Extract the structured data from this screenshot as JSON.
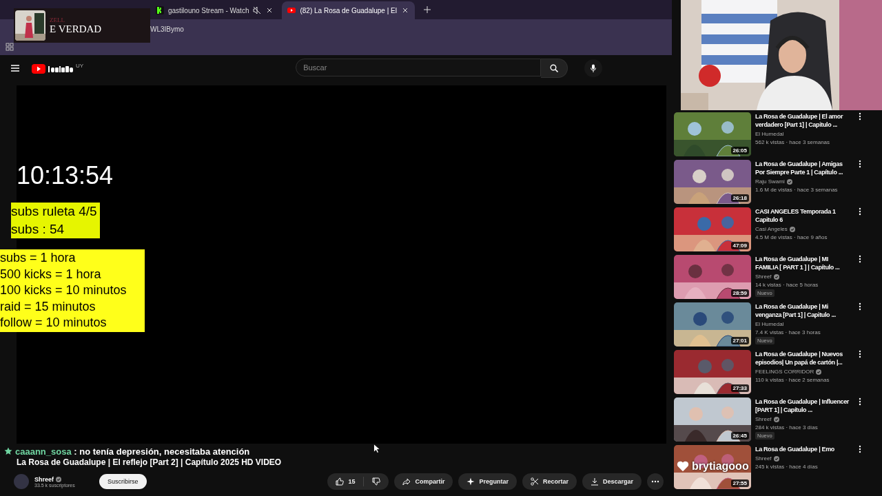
{
  "browser": {
    "tabs": [
      {
        "title": "gastilouno Stream - Watch",
        "kind": "kick",
        "muted": true,
        "selected": false
      },
      {
        "title": "(82) La Rosa de Guadalupe | El",
        "kind": "youtube",
        "muted": false,
        "selected": true
      }
    ],
    "address": "WL3IBymo"
  },
  "music_widget": {
    "line_1": "ZELL",
    "line_2": "E VERDAD"
  },
  "youtube": {
    "region": "UY",
    "search": {
      "placeholder": "Buscar"
    }
  },
  "stream_overlay": {
    "timer": "10:13:54",
    "subs_box": [
      "subs ruleta 4/5",
      "subs : 54"
    ],
    "rules_box": [
      "subs = 1 hora",
      "500 kicks = 1 hora",
      "100 kicks = 10 minutos",
      "raid = 15 minutos",
      "follow = 10 minutos"
    ]
  },
  "chat": {
    "user": "caaann_sosa",
    "message": ": no tenía depresión, necesitaba atención"
  },
  "video": {
    "title": "La Rosa de Guadalupe | El reflejo [Part 2] | Capítulo 2025 HD VIDEO",
    "channel": "Shreef",
    "verified": true,
    "subscribers": "33.5 k suscriptores",
    "subscribe": "Suscribirse",
    "likes": "15",
    "actions": [
      {
        "kind": "share",
        "label": "Compartir"
      },
      {
        "kind": "ask",
        "label": "Preguntar"
      },
      {
        "kind": "clip",
        "label": "Recortar"
      },
      {
        "kind": "download",
        "label": "Descargar"
      }
    ]
  },
  "recommended": [
    {
      "title": "La Rosa de Guadalupe | El amor verdadero [Part 1] | Capitulo ...",
      "channel": "El Humedal",
      "verified": false,
      "meta": "562 k vistas · hace 3 semanas",
      "duration": "26:05"
    },
    {
      "title": "La Rosa de Guadalupe | Amigas Por Siempre Parte 1 | Capítulo ...",
      "channel": "Raju Swami",
      "verified": true,
      "meta": "1.6 M de vistas · hace 3 semanas",
      "duration": "26:18"
    },
    {
      "title": "CASI ANGELES Temporada 1 Capitulo 6",
      "channel": "Casi Angeles",
      "verified": true,
      "meta": "4.5 M de vistas · hace 9 años",
      "duration": "47:09"
    },
    {
      "title": "La Rosa de Guadalupe | MI FAMILIA [ PART 1 ] | Capítulo ...",
      "channel": "Shreef",
      "verified": true,
      "meta": "14 k vistas · hace 5 horas",
      "duration": "28:59",
      "badge": "Nuevo"
    },
    {
      "title": "La Rosa de Guadalupe | Mi venganza [Part 1] | Capitulo ...",
      "channel": "El Humedal",
      "verified": false,
      "meta": "7.4 K vistas · hace 3 horas",
      "duration": "27:01",
      "badge": "Nuevo"
    },
    {
      "title": "La Rosa de Guadalupe | Nuevos episodios| Un papá de cartón |...",
      "channel": "FEELINGS CORRIDOR",
      "verified": true,
      "meta": "110 k vistas · hace 2 semanas",
      "duration": "27:33"
    },
    {
      "title": "La Rosa de Guadalupe | Influencer [PART 1] | Capítulo ...",
      "channel": "Shreef",
      "verified": true,
      "meta": "284 k vistas · hace 3 días",
      "duration": "26:45",
      "badge": "Nuevo"
    },
    {
      "title": "La Rosa de Guadalupe | Emo",
      "channel": "Shreef",
      "verified": true,
      "meta": "245 k vistas · hace 4 días",
      "duration": "27:55"
    }
  ],
  "follower_alert": "brytiagooo"
}
